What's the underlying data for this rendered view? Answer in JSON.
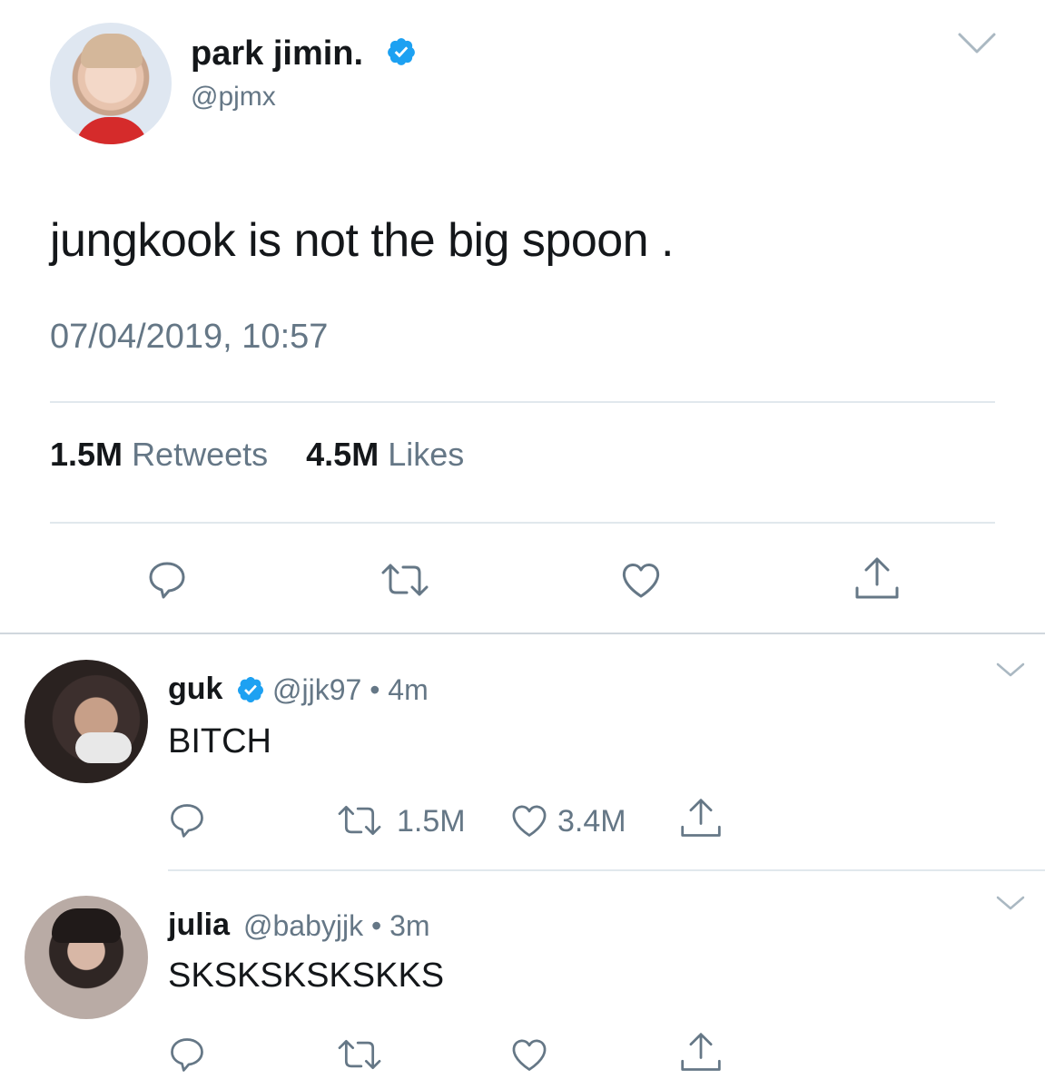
{
  "main": {
    "name": "park jimin.",
    "handle": "@pjmx",
    "text": "jungkook is not the big spoon .",
    "timestamp": "07/04/2019, 10:57",
    "retweets_count": "1.5M",
    "retweets_label": "Retweets",
    "likes_count": "4.5M",
    "likes_label": "Likes"
  },
  "replies": [
    {
      "name": "guk",
      "handle_time": "@jjk97 • 4m",
      "text": "BITCH",
      "retweets": "1.5M",
      "likes": "3.4M"
    },
    {
      "name": "julia",
      "handle_time": "@babyjjk • 3m",
      "text": "SKSKSKSKSKKS"
    }
  ],
  "icons": {
    "verified": "verified-badge-icon",
    "chevron": "chevron-down-icon",
    "reply": "reply-icon",
    "retweet": "retweet-icon",
    "like": "heart-icon",
    "share": "share-icon"
  },
  "colors": {
    "text_primary": "#14171a",
    "text_secondary": "#657786",
    "divider": "#e1e8ed",
    "verified_blue": "#1da1f2"
  }
}
